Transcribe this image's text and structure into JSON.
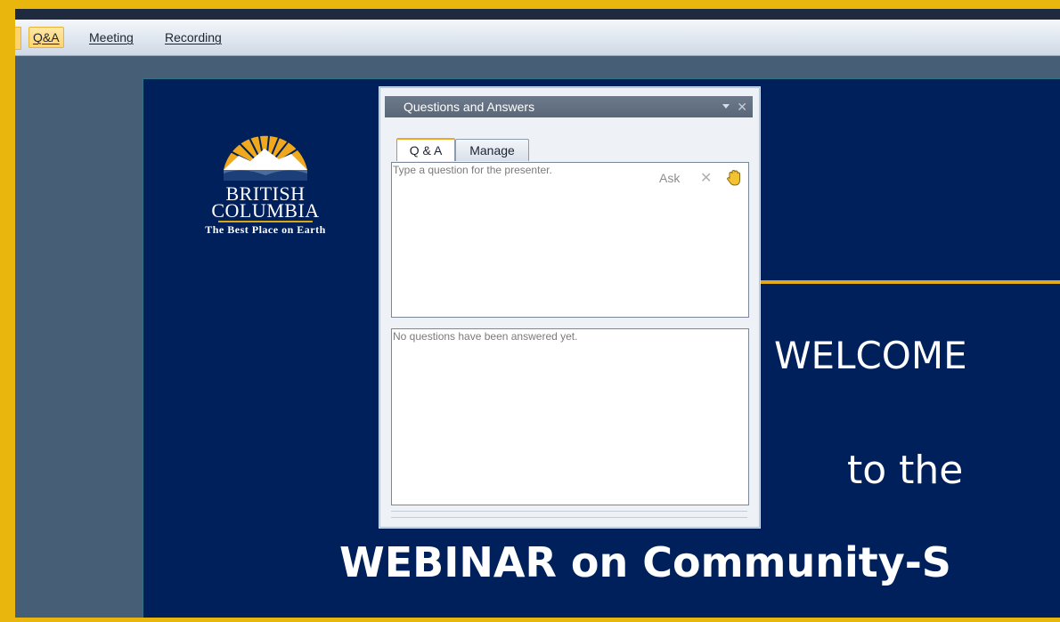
{
  "menu": {
    "items": [
      {
        "label": "Q&A",
        "active": true
      },
      {
        "label": "Meeting",
        "active": false
      },
      {
        "label": "Recording",
        "active": false
      }
    ]
  },
  "slide": {
    "logo": {
      "line1": "BRITISH",
      "line2": "COLUMBIA",
      "tagline": "The Best Place on Earth"
    },
    "welcome": "WELCOME",
    "to_the": "to the",
    "webinar": "WEBINAR on Community-S"
  },
  "qa_panel": {
    "title": "Questions and Answers",
    "tabs": [
      "Q & A",
      "Manage"
    ],
    "question_placeholder": "Type a question for the presenter.",
    "ask_label": "Ask",
    "answered_text": "No questions have been answered yet."
  },
  "colors": {
    "frame_gold": "#e8b60c",
    "slide_navy": "#00205b",
    "app_background": "#465e76"
  },
  "icons": [
    "dropdown-arrow-icon",
    "close-icon",
    "clear-icon",
    "raise-hand-icon",
    "sun-mountains-icon"
  ]
}
